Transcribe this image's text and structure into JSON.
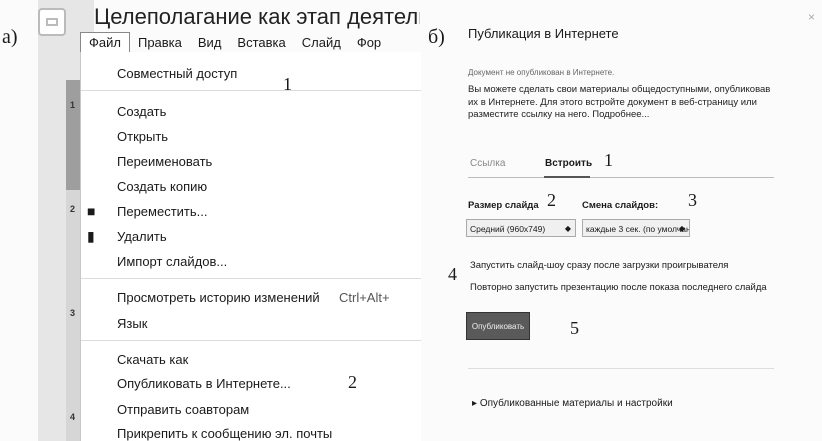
{
  "panel_a": {
    "label": "а)",
    "doc_title": "Целеполагание как этап деятельн",
    "menubar": [
      "Файл",
      "Правка",
      "Вид",
      "Вставка",
      "Слайд",
      "Фор"
    ],
    "thumb_numbers": [
      "1",
      "2",
      "3",
      "4"
    ],
    "menu": {
      "share": "Совместный доступ",
      "create": "Создать",
      "open": "Открыть",
      "rename": "Переименовать",
      "copy": "Создать копию",
      "move": "Переместить...",
      "delete": "Удалить",
      "import": "Импорт слайдов...",
      "history": "Просмотреть историю изменений",
      "history_shortcut": "Ctrl+Alt+",
      "language": "Язык",
      "download": "Скачать как",
      "publish": "Опубликовать в Интернете...",
      "send": "Отправить соавторам",
      "attach": "Прикрепить к сообщению эл. почты"
    },
    "callouts": {
      "c1": "1",
      "c2": "2"
    }
  },
  "panel_b": {
    "label": "б)",
    "title": "Публикация в Интернете",
    "close": "×",
    "status": "Документ не опубликован в Интернете.",
    "description": "Вы можете сделать свои материалы общедоступными, опубликовав их в Интернете. Для этого встройте документ в веб-страницу или разместите ссылку на него. Подробнее...",
    "tabs": [
      "Ссылка",
      "Встроить"
    ],
    "slide_size_label": "Размер слайда",
    "slide_size_value": "Средний (960x749)",
    "slide_change_label": "Смена слайдов:",
    "slide_change_value": "каждые 3 сек. (по умолчан",
    "option1": "Запустить слайд-шоу сразу после загрузки проигрывателя",
    "option2": "Повторно запустить презентацию после показа последнего слайда",
    "publish_button": "Опубликовать",
    "published_settings": "Опубликованные материалы и настройки",
    "callouts": {
      "c1": "1",
      "c2": "2",
      "c3": "3",
      "c4": "4",
      "c5": "5"
    }
  }
}
